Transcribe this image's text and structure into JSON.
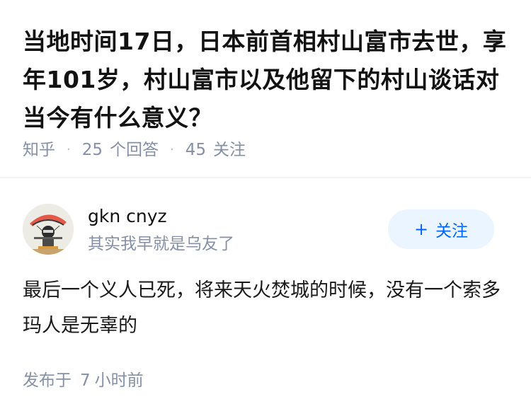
{
  "question": {
    "title": "当地时间17日，日本前首相村山富市去世，享年101岁，村山富市以及他留下的村山谈话对当今有什么意义？",
    "source": "知乎",
    "answer_count": "25",
    "answer_label": "个回答",
    "follower_count": "45",
    "follower_label": "关注"
  },
  "answer": {
    "author_name": "gkn cnyz",
    "author_bio": "其实我早就是乌友了",
    "follow_label": "关注",
    "follow_icon": "+",
    "content": "最后一个义人已死，将来天火焚城的时候，没有一个索多玛人是无辜的",
    "time_prefix": "发布于",
    "time_value": "7",
    "time_suffix": "小时前"
  },
  "colors": {
    "accent": "#0066ff",
    "follow_bg": "#ebf5ff",
    "meta_text": "#8590a6",
    "title_text": "#121212"
  }
}
